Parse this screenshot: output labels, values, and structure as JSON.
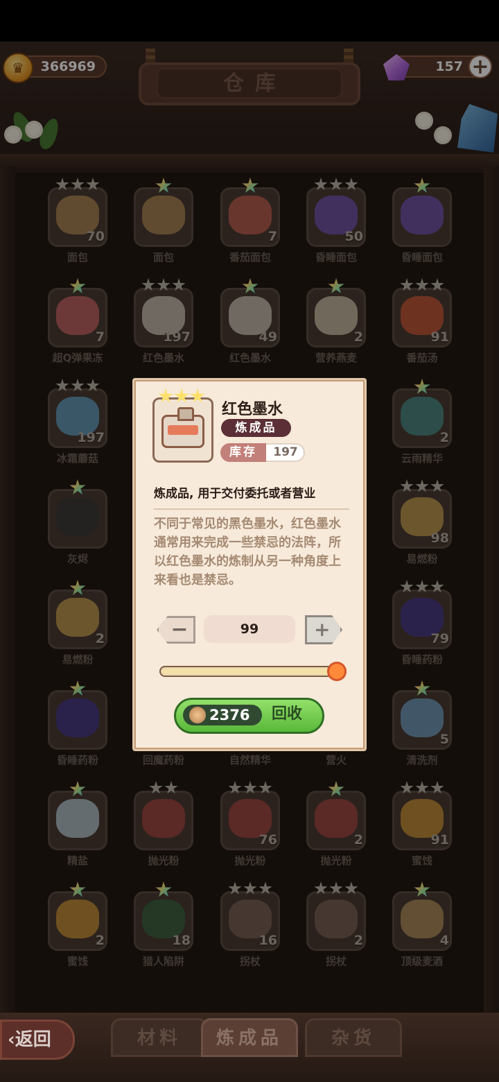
{
  "currency": {
    "coins": "366969",
    "gems": "157"
  },
  "header": {
    "title": "仓库"
  },
  "grid": {
    "rows": [
      [
        {
          "name": "面包",
          "count": "70",
          "stars": 3,
          "art": "#c79a5f"
        },
        {
          "name": "面包",
          "count": "",
          "stars": "rainbow",
          "art": "#c79a5f"
        },
        {
          "name": "番茄面包",
          "count": "7",
          "stars": "rainbow",
          "art": "#d96a5a"
        },
        {
          "name": "昏睡面包",
          "count": "50",
          "stars": 3,
          "art": "#7d5cc9"
        },
        {
          "name": "昏睡面包",
          "count": "",
          "stars": "rainbow",
          "art": "#7d5cc9"
        }
      ],
      [
        {
          "name": "超Q弹果冻",
          "count": "7",
          "stars": "rainbow",
          "art": "#e26f72"
        },
        {
          "name": "红色墨水",
          "count": "197",
          "stars": 3,
          "art": "#e8ddd2"
        },
        {
          "name": "红色墨水",
          "count": "49",
          "stars": "rainbow",
          "art": "#e8ddd2"
        },
        {
          "name": "营养燕麦",
          "count": "2",
          "stars": "rainbow",
          "art": "#eadbc0"
        },
        {
          "name": "番茄汤",
          "count": "91",
          "stars": 3,
          "art": "#e4603d"
        }
      ],
      [
        {
          "name": "冰霜蘑菇",
          "count": "197",
          "stars": 3,
          "art": "#6fb4df"
        },
        {
          "name": "",
          "count": "",
          "stars": 0,
          "art": ""
        },
        {
          "name": "",
          "count": "",
          "stars": 0,
          "art": ""
        },
        {
          "name": "",
          "count": "",
          "stars": 0,
          "art": ""
        },
        {
          "name": "云雨精华",
          "count": "2",
          "stars": "rainbow",
          "art": "#4f9e9b"
        }
      ],
      [
        {
          "name": "灰烬",
          "count": "",
          "stars": "rainbow",
          "art": "#3b3b3b"
        },
        {
          "name": "",
          "count": "",
          "stars": 0,
          "art": ""
        },
        {
          "name": "",
          "count": "",
          "stars": 0,
          "art": ""
        },
        {
          "name": "",
          "count": "",
          "stars": 0,
          "art": ""
        },
        {
          "name": "易燃粉",
          "count": "98",
          "stars": 3,
          "art": "#e2b35a"
        }
      ],
      [
        {
          "name": "易燃粉",
          "count": "2",
          "stars": "rainbow",
          "art": "#e2b35a"
        },
        {
          "name": "",
          "count": "",
          "stars": 0,
          "art": ""
        },
        {
          "name": "",
          "count": "",
          "stars": 0,
          "art": ""
        },
        {
          "name": "",
          "count": "",
          "stars": 0,
          "art": ""
        },
        {
          "name": "昏睡药粉",
          "count": "79",
          "stars": 3,
          "art": "#4b3c9c"
        }
      ],
      [
        {
          "name": "昏睡药粉",
          "count": "",
          "stars": "rainbow",
          "art": "#4b3c9c"
        },
        {
          "name": "回魔药粉",
          "count": "",
          "stars": 0,
          "art": ""
        },
        {
          "name": "自然精华",
          "count": "",
          "stars": 0,
          "art": ""
        },
        {
          "name": "营火",
          "count": "",
          "stars": 0,
          "art": ""
        },
        {
          "name": "清洗剂",
          "count": "5",
          "stars": "rainbow",
          "art": "#7fb4dd"
        }
      ],
      [
        {
          "name": "精盐",
          "count": "",
          "stars": "rainbow",
          "art": "#cfe4f2"
        },
        {
          "name": "抛光粉",
          "count": "",
          "stars": 2,
          "art": "#b94b48"
        },
        {
          "name": "抛光粉",
          "count": "76",
          "stars": 3,
          "art": "#b94b48"
        },
        {
          "name": "抛光粉",
          "count": "2",
          "stars": "rainbow",
          "art": "#b94b48"
        },
        {
          "name": "蜜饯",
          "count": "91",
          "stars": 3,
          "art": "#e8a63a"
        }
      ],
      [
        {
          "name": "蜜饯",
          "count": "2",
          "stars": "rainbow",
          "art": "#e8a63a"
        },
        {
          "name": "猎人陷阱",
          "count": "18",
          "stars": "rainbow",
          "art": "#3d6b47"
        },
        {
          "name": "拐杖",
          "count": "16",
          "stars": 3,
          "art": "#8a6d62"
        },
        {
          "name": "拐杖",
          "count": "2",
          "stars": 3,
          "art": "#8a6d62"
        },
        {
          "name": "顶级麦酒",
          "count": "4",
          "stars": "rainbow",
          "art": "#c9a36a"
        }
      ]
    ]
  },
  "popup": {
    "item_name": "红色墨水",
    "category": "炼成品",
    "stock_label": "库存",
    "stock_value": "197",
    "subtitle": "炼成品, 用于交付委托或者营业",
    "description": "不同于常见的黑色墨水，红色墨水通常用来完成一些禁忌的法阵，所以红色墨水的炼制从另一种角度上来看也是禁忌。",
    "quantity": "99",
    "quantity_fraction": 0.99,
    "price": "2376",
    "recycle_label": "回收"
  },
  "tabs": [
    {
      "label": "材料",
      "active": false
    },
    {
      "label": "炼成品",
      "active": true
    },
    {
      "label": "杂货",
      "active": false
    }
  ],
  "back_label": "返回"
}
